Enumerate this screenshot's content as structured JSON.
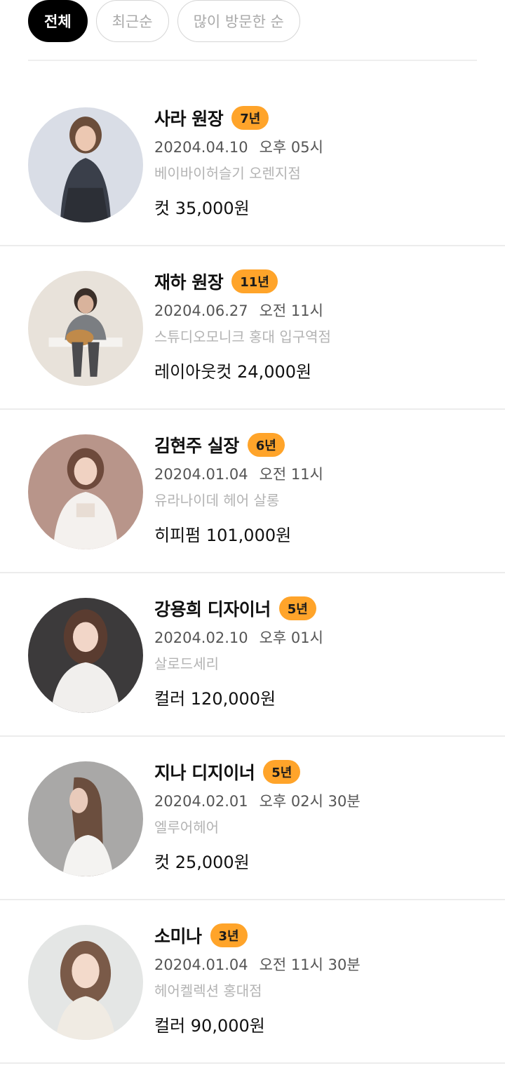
{
  "filters": [
    {
      "label": "전체",
      "active": true
    },
    {
      "label": "최근순",
      "active": false
    },
    {
      "label": "많이 방문한 순",
      "active": false
    }
  ],
  "designers": [
    {
      "name": "사라 원장",
      "years": "7년",
      "date": "20204.04.10",
      "time": "오후 05시",
      "salon": "베이바이허슬기 오렌지점",
      "price": "컷 35,000원"
    },
    {
      "name": "재하 원장",
      "years": "11년",
      "date": "20204.06.27",
      "time": "오전 11시",
      "salon": "스튜디오모니크 홍대 입구역점",
      "price": "레이아웃컷 24,000원"
    },
    {
      "name": "김현주 실장",
      "years": "6년",
      "date": "20204.01.04",
      "time": "오전 11시",
      "salon": "유라나이데 헤어 살롱",
      "price": "히피펌 101,000원"
    },
    {
      "name": "강용희 디자이너",
      "years": "5년",
      "date": "20204.02.10",
      "time": "오후 01시",
      "salon": "살로드세리",
      "price": "컬러 120,000원"
    },
    {
      "name": "지나 디지이너",
      "years": "5년",
      "date": "20204.02.01",
      "time": "오후 02시 30분",
      "salon": "엘루어헤어",
      "price": "컷 25,000원"
    },
    {
      "name": "소미나",
      "years": "3년",
      "date": "20204.01.04",
      "time": "오전 11시 30분",
      "salon": "헤어켈렉션 홍대점",
      "price": "컬러 90,000원"
    }
  ],
  "colors": {
    "badge": "#ffa42a",
    "active_chip": "#000000"
  }
}
